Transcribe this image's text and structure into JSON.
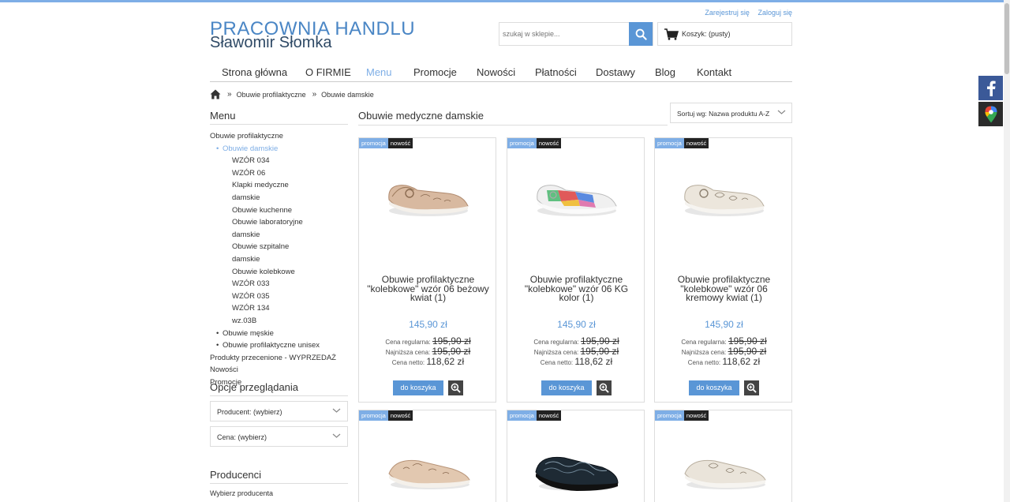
{
  "header": {
    "logo_line1": "PRACOWNIA HANDLU",
    "logo_line2": "Sławomir Słomka",
    "register_link": "Zarejestruj się",
    "login_link": "Zaloguj się",
    "search_placeholder": "szukaj w sklepie...",
    "cart_label": "Koszyk: (pusty)"
  },
  "nav": {
    "items": [
      {
        "label": "Strona główna",
        "active": false
      },
      {
        "label": "O FIRMIE",
        "active": false
      },
      {
        "label": "Menu",
        "active": true
      },
      {
        "label": "Promocje",
        "active": false
      },
      {
        "label": "Nowości",
        "active": false
      },
      {
        "label": "Płatności",
        "active": false
      },
      {
        "label": "Dostawy",
        "active": false
      },
      {
        "label": "Blog",
        "active": false
      },
      {
        "label": "Kontakt",
        "active": false
      }
    ]
  },
  "breadcrumb": {
    "sep": "»",
    "items": [
      "Obuwie profilaktyczne",
      "Obuwie damskie"
    ]
  },
  "sidebar": {
    "menu_title": "Menu",
    "menu": {
      "root": "Obuwie profilaktyczne",
      "current": "Obuwie damskie",
      "sub": [
        "WZÓR 034",
        "WZÓR 06",
        "Klapki medyczne damskie",
        "Obuwie kuchenne",
        "Obuwie laboratoryjne damskie",
        "Obuwie szpitalne damskie",
        "Obuwie kolebkowe",
        "WZÓR 033",
        "WZÓR 035",
        "WZÓR 134",
        "wz.03B"
      ],
      "siblings": [
        "Obuwie męskie",
        "Obuwie profilaktyczne unisex"
      ],
      "top": [
        "Produkty przecenione - WYPRZEDAŻ",
        "Nowości",
        "Promocje"
      ]
    },
    "view_title": "Opcje przeglądania",
    "producer_filter": "Producent: (wybierz)",
    "price_filter": "Cena: (wybierz)",
    "producers_title": "Producenci",
    "producers_select": "Wybierz producenta"
  },
  "main": {
    "title": "Obuwie medyczne damskie",
    "sort_label": "Sortuj wg: Nazwa produktu A-Z",
    "labels": {
      "regular": "Cena regularna:",
      "lowest": "Najniższa cena:",
      "net": "Cena netto:",
      "add": "do koszyka",
      "promo": "promocja",
      "new": "nowość"
    },
    "products": [
      {
        "name": "Obuwie profilaktyczne \"kolebkowe\" wzór 06 beżowy kwiat (1)",
        "price": "145,90 zł",
        "regular": "195,90 zł",
        "lowest": "195,90 zł",
        "net": "118,62 zł"
      },
      {
        "name": "Obuwie profilaktyczne \"kolebkowe\" wzór 06 KG kolor (1)",
        "price": "145,90 zł",
        "regular": "195,90 zł",
        "lowest": "195,90 zł",
        "net": "118,62 zł"
      },
      {
        "name": "Obuwie profilaktyczne \"kolebkowe\" wzór 06 kremowy kwiat (1)",
        "price": "145,90 zł",
        "regular": "195,90 zł",
        "lowest": "195,90 zł",
        "net": "118,62 zł"
      },
      {
        "name": "",
        "price": "",
        "regular": "",
        "lowest": "",
        "net": ""
      },
      {
        "name": "",
        "price": "",
        "regular": "",
        "lowest": "",
        "net": ""
      },
      {
        "name": "",
        "price": "",
        "regular": "",
        "lowest": "",
        "net": ""
      }
    ]
  },
  "colors": {
    "accent": "#5a96d6",
    "accent_light": "#7eaee6",
    "facebook": "#3b5998"
  },
  "icons": [
    "home-icon",
    "search-icon",
    "cart-icon",
    "chevron-down-icon",
    "zoom-icon",
    "facebook-icon",
    "google-maps-icon"
  ]
}
